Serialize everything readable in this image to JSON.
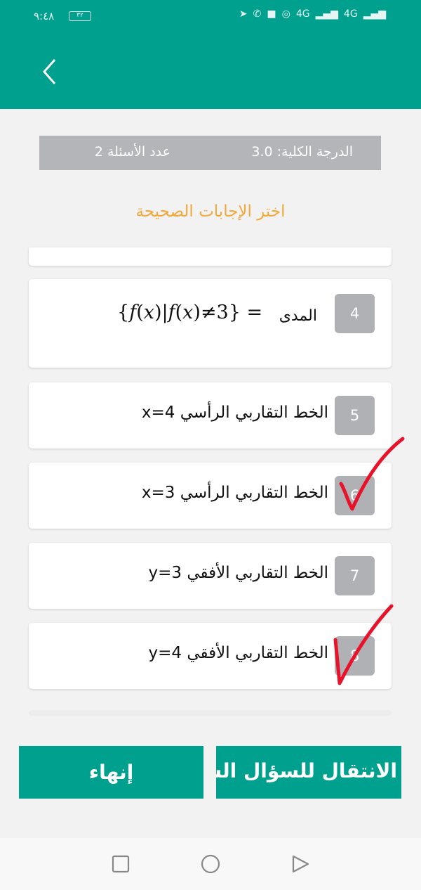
{
  "status_bar": {
    "time": "٩:٤٨",
    "battery": "٣٢",
    "signal_1": "4G",
    "signal_2": "4G"
  },
  "header": {
    "back_icon": "chevron-left-icon"
  },
  "info": {
    "total_label": "الدرجة الكلية:",
    "total_value": "3.0",
    "count_label": "عدد الأسئلة",
    "count_value": "2"
  },
  "prompt": "اختر الإجابات الصحيحة",
  "options": [
    {
      "num": "4",
      "label": "المدى",
      "equals": "="
    },
    {
      "num": "5",
      "text": "الخط التقاربي الرأسي x=4"
    },
    {
      "num": "6",
      "text": "الخط التقاربي الرأسي x=3",
      "marked": true
    },
    {
      "num": "7",
      "text": "الخط التقاربي الأفقي y=3"
    },
    {
      "num": "8",
      "text": "الخط التقاربي الأفقي y=4",
      "marked": true
    }
  ],
  "buttons": {
    "finish": "إنهاء",
    "next": "الانتقال للسؤال السابق"
  },
  "colors": {
    "primary": "#00a08e",
    "accent": "#f0a93a",
    "badge": "#b0b1b5",
    "check": "#e8132a"
  },
  "nav": [
    "square-icon",
    "circle-icon",
    "triangle-icon"
  ]
}
